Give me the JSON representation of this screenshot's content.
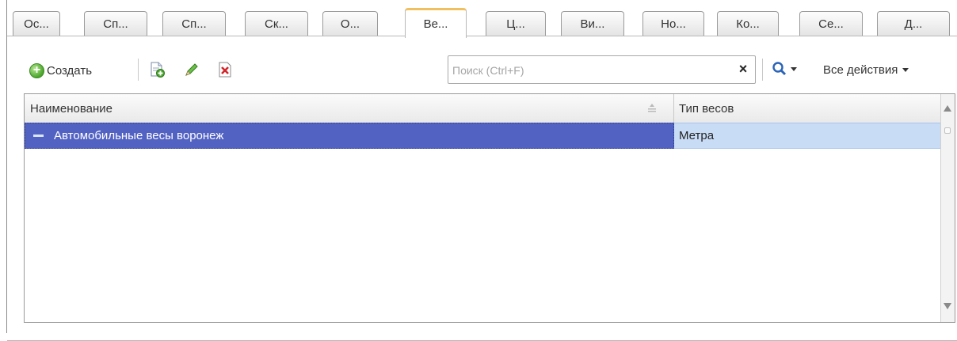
{
  "tabs": [
    {
      "label": "Ос...",
      "active": false
    },
    {
      "label": "Сп...",
      "active": false
    },
    {
      "label": "Сп...",
      "active": false
    },
    {
      "label": "Ск...",
      "active": false
    },
    {
      "label": "О...",
      "active": false
    },
    {
      "label": "Ве...",
      "active": true
    },
    {
      "label": "Ц...",
      "active": false
    },
    {
      "label": "Ви...",
      "active": false
    },
    {
      "label": "Но...",
      "active": false
    },
    {
      "label": "Ко...",
      "active": false
    },
    {
      "label": "Се...",
      "active": false
    },
    {
      "label": "Д...",
      "active": false
    }
  ],
  "toolbar": {
    "create_label": "Создать",
    "create_icon": "plus-circle-icon",
    "copy_icon": "copy-document-icon",
    "edit_icon": "pencil-icon",
    "delete_icon": "delete-mark-icon",
    "search_placeholder": "Поиск (Ctrl+F)",
    "search_value": "",
    "clear_icon": "clear-x-icon",
    "find_icon": "magnifier-icon",
    "all_actions_label": "Все действия"
  },
  "table": {
    "columns": [
      "Наименование",
      "Тип весов"
    ],
    "rows": [
      {
        "name": "Автомобильные весы воронеж",
        "type": "Метра",
        "selected": true
      }
    ]
  },
  "colors": {
    "selection": "#5262c2",
    "selection_secondary": "#c9dcf6",
    "active_tab_accent": "#f0c060"
  }
}
